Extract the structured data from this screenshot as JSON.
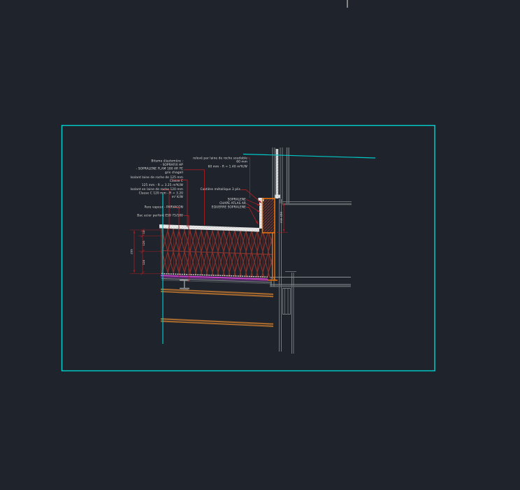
{
  "window": {
    "description": "CAD viewport with roof edge construction detail",
    "cursor_tick": "|"
  },
  "colors": {
    "background": "#1f242c",
    "viewport_border": "#00d2d2",
    "section_cyan": "#00c8c8",
    "leader_red": "#a51d23",
    "hatch_red": "#8a332d",
    "flashing_orange": "#e8700d",
    "vapour_magenta": "#cb41ce",
    "vapour_purple": "#8d33a6",
    "purlin_brown": "#a5682e",
    "structure_gray": "#73787d",
    "text": "#dededc"
  },
  "annotations": {
    "membrane_block": {
      "lines": [
        "Bitume élastomère :",
        "-  SOPRAFIX HP",
        "-  SOPRALENE FLAM 180 AR FE",
        "gris chagall"
      ]
    },
    "insulation_block": {
      "lines": [
        "Isolant laine de roche de 125 mm",
        "Classe C",
        "125 mm  -  R = 3.25 m²K/W",
        "Isolant en laine de roche 120 mm",
        "Classe C 120 mm  -  R = 3.20",
        "m² K/W"
      ]
    },
    "vapour_barrier_label": "Pare vapeur  -  PARVACON",
    "steel_deck_label": "Bac acier perforé E59 75/100",
    "upstand_block": {
      "lines": [
        "relevé par laine de roche soudable",
        "60 mm",
        "60 mm  -  R = 1.40 m²K/W"
      ]
    },
    "flashing_label": "Costière métallique 3 plis",
    "corner_block": {
      "lines": [
        "SOPRALENE",
        "CHAPE ATLAS AR",
        "EQUERRE SOPRALENE"
      ]
    },
    "dimensions": {
      "total": "255",
      "seg_top": "10",
      "seg_mid": "125",
      "seg_bot": "120",
      "upstand_height": "min 150"
    }
  }
}
